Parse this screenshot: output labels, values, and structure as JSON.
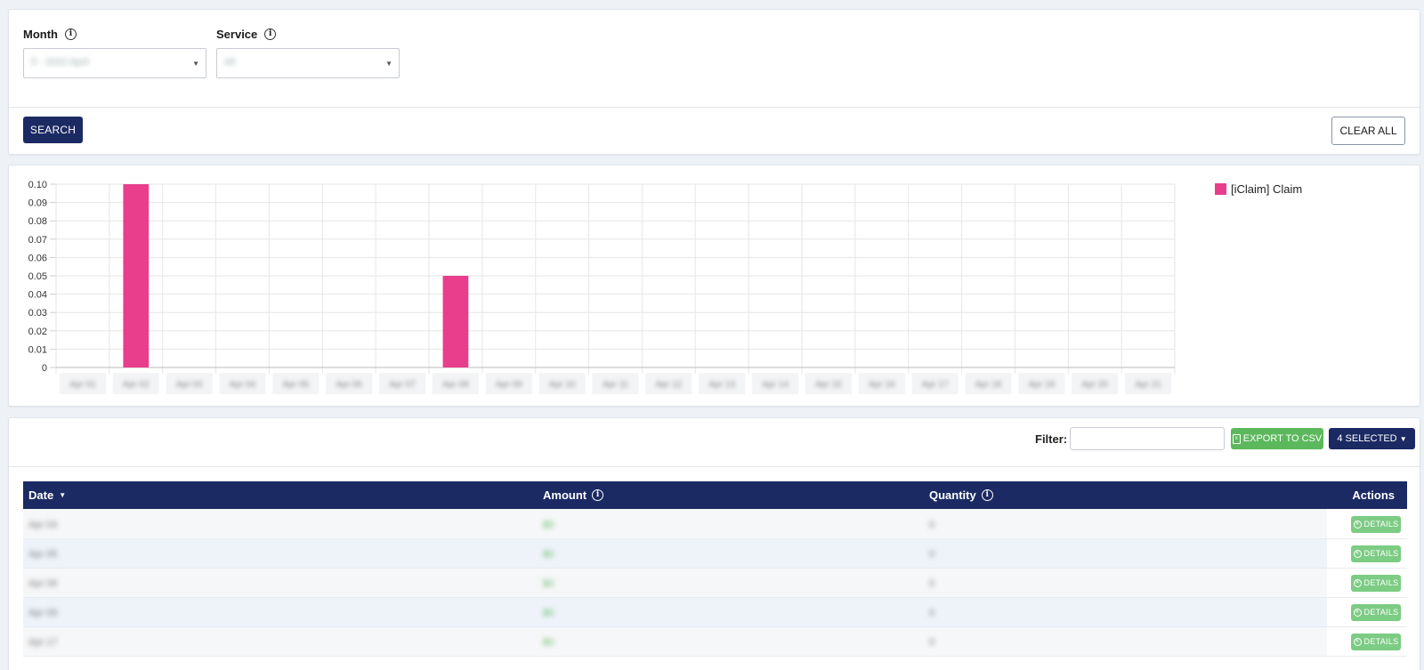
{
  "filters": {
    "month_label": "Month",
    "month_value": "5 - 2022 April",
    "service_label": "Service",
    "service_value": "All",
    "search_label": "SEARCH",
    "clear_label": "CLEAR ALL"
  },
  "chart_data": {
    "type": "bar",
    "categories": [
      "Apr 01",
      "Apr 02",
      "Apr 03",
      "Apr 04",
      "Apr 05",
      "Apr 06",
      "Apr 07",
      "Apr 08",
      "Apr 09",
      "Apr 10",
      "Apr 11",
      "Apr 12",
      "Apr 13",
      "Apr 14",
      "Apr 15",
      "Apr 16",
      "Apr 17",
      "Apr 18",
      "Apr 19",
      "Apr 20",
      "Apr 21"
    ],
    "series": [
      {
        "name": "[iClaim] Claim",
        "values": [
          0,
          0.1,
          0,
          0,
          0,
          0,
          0,
          0.05,
          0,
          0,
          0,
          0,
          0,
          0,
          0,
          0,
          0,
          0,
          0,
          0,
          0
        ]
      }
    ],
    "yticks": [
      0,
      0.01,
      0.02,
      0.03,
      0.04,
      0.05,
      0.06,
      0.07,
      0.08,
      0.09,
      0.1
    ],
    "ytick_labels": [
      "0",
      "0.01",
      "0.02",
      "0.03",
      "0.04",
      "0.05",
      "0.06",
      "0.07",
      "0.08",
      "0.09",
      "0.10"
    ],
    "ylim": [
      0,
      0.1
    ],
    "grid": true,
    "legend": "top-right",
    "bar_color": "#e83e8c"
  },
  "table": {
    "filter_label": "Filter:",
    "filter_value": "",
    "export_label": "EXPORT TO CSV",
    "selected_label": "4 SELECTED",
    "columns": {
      "date": "Date",
      "amount": "Amount",
      "quantity": "Quantity",
      "actions": "Actions"
    },
    "details_label": "DETAILS",
    "rows": [
      {
        "date": "Apr 04",
        "amount": "$0",
        "quantity": "0"
      },
      {
        "date": "Apr 05",
        "amount": "$0",
        "quantity": "0"
      },
      {
        "date": "Apr 06",
        "amount": "$0",
        "quantity": "0"
      },
      {
        "date": "Apr 09",
        "amount": "$0",
        "quantity": "0"
      },
      {
        "date": "Apr 17",
        "amount": "$0",
        "quantity": "0"
      }
    ]
  },
  "colors": {
    "primary": "#1b2a63",
    "success": "#5cb85c",
    "bar": "#e83e8c"
  }
}
